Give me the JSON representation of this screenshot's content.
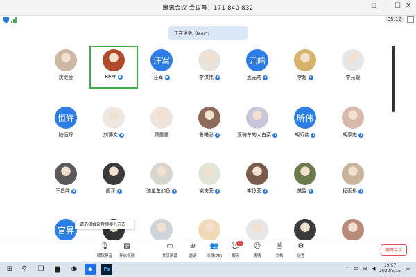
{
  "window": {
    "title": "腾讯会议  会议号：171 840 832",
    "timer": "35:12"
  },
  "speaking_banner": "正在讲话: Beer*;",
  "participants": [
    {
      "name": "沈继莹",
      "type": "photo",
      "color": "#cdb8a4",
      "mic": false
    },
    {
      "name": "Beer",
      "type": "photo",
      "color": "#b04a2a",
      "mic": true,
      "active": true
    },
    {
      "name": "汪军",
      "type": "text",
      "initials": "汪军",
      "mic": true
    },
    {
      "name": "李洪伟",
      "type": "photo",
      "color": "#e8e4dc",
      "mic": true
    },
    {
      "name": "孟元皓",
      "type": "text",
      "initials": "元皓",
      "mic": true
    },
    {
      "name": "李超",
      "type": "photo",
      "color": "#d6b36a",
      "mic": true
    },
    {
      "name": "李元媛",
      "type": "photo",
      "color": "#e6e6e6",
      "mic": false
    },
    {
      "name": "陆恒辉",
      "type": "text",
      "initials": "恒辉",
      "mic": false
    },
    {
      "name": "刘博文",
      "type": "photo",
      "color": "#efe7e3",
      "mic": true
    },
    {
      "name": "顾童童",
      "type": "photo",
      "color": "#efe4dc",
      "mic": false
    },
    {
      "name": "鲁曦澎",
      "type": "photo",
      "color": "#8d6a5a",
      "mic": true
    },
    {
      "name": "爱骑车的大白菜",
      "type": "photo",
      "color": "#c9c6d8",
      "mic": true
    },
    {
      "name": "胡昕伟",
      "type": "text",
      "initials": "昕伟",
      "mic": true
    },
    {
      "name": "胡厚态",
      "type": "photo",
      "color": "#d8b8a8",
      "mic": true
    },
    {
      "name": "王昌胜",
      "type": "photo",
      "color": "#5a5a5a",
      "mic": true
    },
    {
      "name": "周正",
      "type": "photo",
      "color": "#3a3a3a",
      "mic": true
    },
    {
      "name": "骑单车的鱼",
      "type": "photo",
      "color": "#d9d6cf",
      "mic": true
    },
    {
      "name": "谢志荣",
      "type": "photo",
      "color": "#dfe6d6",
      "mic": true
    },
    {
      "name": "李玲荣",
      "type": "photo",
      "color": "#7a5a4a",
      "mic": true
    },
    {
      "name": "苏晓",
      "type": "photo",
      "color": "#6a7a4a",
      "mic": true
    },
    {
      "name": "程雨彤",
      "type": "photo",
      "color": "#c9b49a",
      "mic": true
    },
    {
      "name": "",
      "type": "text",
      "initials": "官昇",
      "mic": false
    },
    {
      "name": "",
      "type": "photo",
      "color": "#333333",
      "mic": false
    },
    {
      "name": "",
      "type": "photo",
      "color": "#cfd4da",
      "mic": false
    },
    {
      "name": "",
      "type": "photo",
      "color": "#f0d9b5",
      "mic": false
    },
    {
      "name": "",
      "type": "photo",
      "color": "#e9e6e6",
      "mic": false
    },
    {
      "name": "",
      "type": "photo",
      "color": "#3a3a3a",
      "mic": false
    },
    {
      "name": "",
      "type": "photo",
      "color": "#b78a7a",
      "mic": false
    }
  ],
  "tooltip": "请选择会议音频接入方式",
  "toolbar": {
    "items": [
      {
        "label": "解除静音",
        "icon": "microphone-muted-icon"
      },
      {
        "label": "开启视频",
        "icon": "camera-off-icon"
      },
      {
        "label": "共享屏幕",
        "icon": "share-screen-icon"
      },
      {
        "label": "邀请",
        "icon": "invite-icon"
      },
      {
        "label": "成员(75)",
        "icon": "members-icon"
      },
      {
        "label": "聊天",
        "icon": "chat-icon",
        "badge": "11"
      },
      {
        "label": "表情",
        "icon": "emoji-icon"
      },
      {
        "label": "文档",
        "icon": "document-icon"
      },
      {
        "label": "设置",
        "icon": "settings-icon"
      }
    ],
    "leave_label": "离开会议"
  },
  "taskbar": {
    "time": "19:57",
    "date": "2020/5/15",
    "ime": "中",
    "ps_label": "Ps"
  }
}
